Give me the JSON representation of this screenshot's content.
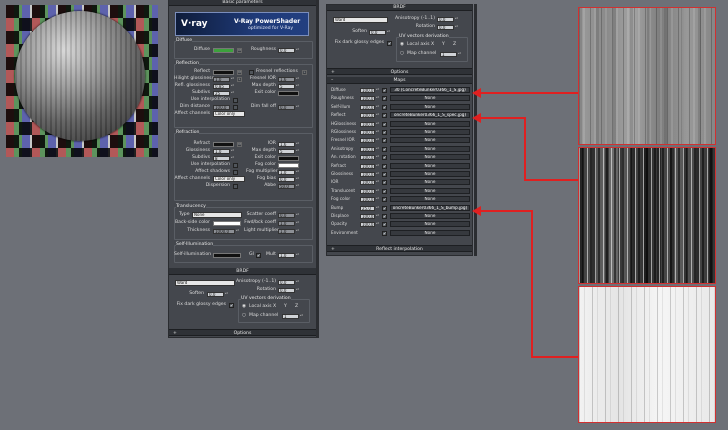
{
  "left_panel": {
    "header": "Basic parameters",
    "brand_logo": "V·ray",
    "brand_title": "V-Ray PowerShader",
    "brand_subtitle": "optimized for V-Ray",
    "diffuse": {
      "group": "Diffuse",
      "diffuse_label": "Diffuse",
      "diffuse_btn": "M",
      "roughness_label": "Roughness",
      "roughness_val": "0,0"
    },
    "reflection": {
      "group": "Reflection",
      "reflect_label": "Reflect",
      "reflect_btn": "M",
      "hilight_label": "Hilight glossiness",
      "hilight_val": "1,0",
      "hilight_btn": "L",
      "refl_gloss_label": "Refl. glossiness",
      "refl_gloss_val": "0,85",
      "subdivs_label": "Subdivs",
      "subdivs_val": "25",
      "use_interp_label": "Use interpolation",
      "dim_dist_label": "Dim distance",
      "dim_dist_val": "100,0",
      "affect_ch_label": "Affect channels",
      "affect_ch_val": "Color only",
      "fresnel_label": "Fresnel reflections",
      "fresnel_ior_label": "Fresnel IOR",
      "fresnel_ior_val": "1,6",
      "max_depth_label": "Max depth",
      "max_depth_val": "5",
      "exit_color_label": "Exit color",
      "dim_falloff_label": "Dim fall off",
      "dim_falloff_val": "0,0"
    },
    "refraction": {
      "group": "Refraction",
      "refract_label": "Refract",
      "glossiness_label": "Glossiness",
      "glossiness_val": "1,0",
      "subdivs_label": "Subdivs",
      "subdivs_val": "8",
      "use_interp_label": "Use interpolation",
      "affect_shadows_label": "Affect shadows",
      "affect_ch_label": "Affect channels",
      "affect_ch_val": "Color only",
      "dispersion_label": "Dispersion",
      "ior_label": "IOR",
      "ior_val": "1,6",
      "max_depth_label": "Max depth",
      "max_depth_val": "5",
      "exit_color_label": "Exit color",
      "fog_color_label": "Fog color",
      "fog_mult_label": "Fog multiplier",
      "fog_mult_val": "1,0",
      "fog_bias_label": "Fog bias",
      "fog_bias_val": "0,0",
      "abbe_label": "Abbe",
      "abbe_val": "50,0"
    },
    "translucency": {
      "group": "Translucency",
      "type_label": "Type",
      "type_val": "None",
      "back_color_label": "Back-side color",
      "thickness_label": "Thickness",
      "thickness_val": "1000,0",
      "scatter_label": "Scatter coeff",
      "scatter_val": "0,0",
      "fwdbck_label": "Fwd/bck coeff",
      "fwdbck_val": "1,0",
      "light_mult_label": "Light multiplier",
      "light_mult_val": "1,0"
    },
    "selfillum": {
      "group": "Self-Illumination",
      "label": "Self-illumination",
      "gi_label": "GI",
      "mult_label": "Mult",
      "mult_val": "1,0"
    },
    "brdf_header": "BRDF",
    "brdf": {
      "type_val": "Ward",
      "soften_label": "Soften",
      "soften_val": "0,0",
      "fix_dark_label": "Fix dark glossy edges",
      "aniso_label": "Anisotropy (-1..1)",
      "aniso_val": "0,0",
      "rotation_label": "Rotation",
      "rotation_val": "0,0",
      "uv_label": "UV vectors derivation",
      "local_axis_label": "Local axis",
      "axis_x": "X",
      "axis_y": "Y",
      "axis_z": "Z",
      "map_channel_label": "Map channel",
      "map_channel_val": "1"
    },
    "options_header": "Options"
  },
  "right_panel": {
    "brdf_header": "BRDF",
    "brdf": {
      "type_val": "Ward",
      "soften_label": "Soften",
      "soften_val": "0,0",
      "fix_dark_label": "Fix dark glossy edges",
      "aniso_label": "Anisotropy (-1..1)",
      "aniso_val": "0,0",
      "rotation_label": "Rotation",
      "rotation_val": "0,0",
      "uv_label": "UV vectors derivation",
      "local_axis_label": "Local axis",
      "axis_x": "X",
      "axis_y": "Y",
      "axis_z": "Z",
      "map_channel_label": "Map channel",
      "map_channel_val": "1"
    },
    "options_header": "Options",
    "maps_header": "Maps",
    "maps": [
      {
        "label": "Diffuse",
        "value": "100,0",
        "checked": "✔",
        "map": "30 (ConcreteBunker0366_1_S.jpg)"
      },
      {
        "label": "Roughness",
        "value": "100,0",
        "checked": "✔",
        "map": "None"
      },
      {
        "label": "Self-illum",
        "value": "100,0",
        "checked": "✔",
        "map": "None"
      },
      {
        "label": "Reflect",
        "value": "100,0",
        "checked": "✔",
        "map": "oncreteBunker0366_1_S_spec.jpg)"
      },
      {
        "label": "HGlossiness",
        "value": "100,0",
        "checked": "✔",
        "map": "None"
      },
      {
        "label": "RGlossiness",
        "value": "100,0",
        "checked": "✔",
        "map": "None"
      },
      {
        "label": "Fresnel IOR",
        "value": "100,0",
        "checked": "✔",
        "map": "None"
      },
      {
        "label": "Anisotropy",
        "value": "100,0",
        "checked": "✔",
        "map": "None"
      },
      {
        "label": "An. rotation",
        "value": "100,0",
        "checked": "✔",
        "map": "None"
      },
      {
        "label": "Refract",
        "value": "100,0",
        "checked": "✔",
        "map": "None"
      },
      {
        "label": "Glossiness",
        "value": "100,0",
        "checked": "✔",
        "map": "None"
      },
      {
        "label": "IOR",
        "value": "100,0",
        "checked": "✔",
        "map": "None"
      },
      {
        "label": "Translucent",
        "value": "100,0",
        "checked": "✔",
        "map": "None"
      },
      {
        "label": "Fog color",
        "value": "100,0",
        "checked": "✔",
        "map": "None"
      },
      {
        "label": "Bump",
        "value": "25,0",
        "checked": "✔",
        "map": "oncreteBunker0366_1_S_bump.jpg)"
      },
      {
        "label": "Displace",
        "value": "100,0",
        "checked": "✔",
        "map": "None"
      },
      {
        "label": "Opacity",
        "value": "100,0",
        "checked": "✔",
        "map": "None"
      },
      {
        "label": "Environment",
        "value": "",
        "checked": "✔",
        "map": "None"
      }
    ],
    "reflect_interp_header": "Reflect interpolation"
  },
  "colors": {
    "highlight_red": "#e02020",
    "diffuse_green": "#3ca13c"
  }
}
